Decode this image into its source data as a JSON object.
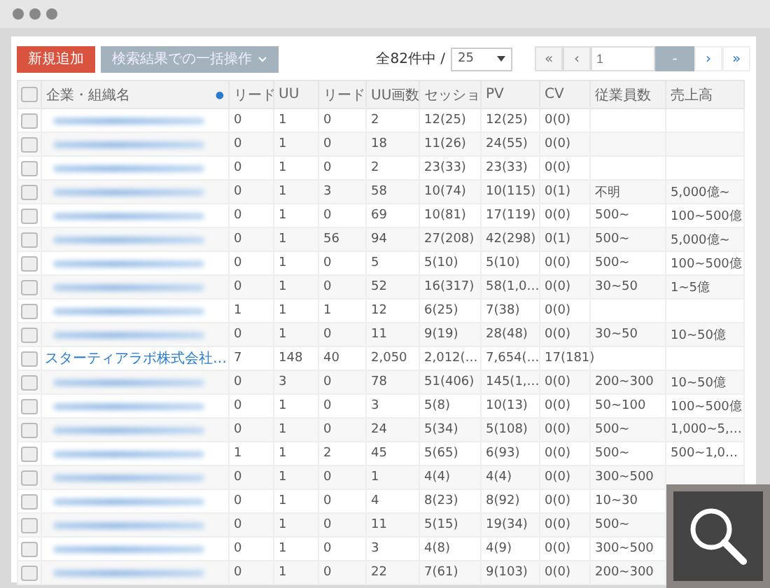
{
  "toolbar": {
    "add_button": "新規追加",
    "bulk_button": "検索結果での一括操作",
    "total": "全82件中 /",
    "per_page": "25",
    "first": "«",
    "prev": "‹",
    "page": "1",
    "page_total": "-",
    "next": "›",
    "last": "»"
  },
  "table": {
    "select_all_checked": false,
    "sort_mark": "●",
    "columns": [
      "企業・組織名",
      "リード",
      "UU",
      "リード",
      "UU画数",
      "セッショ",
      "PV",
      "CV",
      "従業員数",
      "売上高"
    ],
    "rows": [
      {
        "checked": false,
        "name": {
          "kind": "redacted"
        },
        "lead": "0",
        "uu": "1",
        "lead2": "0",
        "uucount": "2",
        "session": "12(25)",
        "pv": "12(25)",
        "cv": "0(0)"
      },
      {
        "checked": false,
        "name": {
          "kind": "redacted"
        },
        "lead": "0",
        "uu": "1",
        "lead2": "0",
        "uucount": "18",
        "session": "11(26)",
        "pv": "24(55)",
        "cv": "0(0)"
      },
      {
        "checked": false,
        "name": {
          "kind": "redacted"
        },
        "lead": "0",
        "uu": "1",
        "lead2": "0",
        "uucount": "2",
        "session": "23(33)",
        "pv": "23(33)",
        "cv": "0(0)"
      },
      {
        "checked": false,
        "name": {
          "kind": "redacted"
        },
        "lead": "0",
        "uu": "1",
        "lead2": "3",
        "uucount": "58",
        "session": "10(74)",
        "pv": "10(115)",
        "cv": "0(1)",
        "employees": "不明",
        "sales": "5,000億~"
      },
      {
        "checked": false,
        "name": {
          "kind": "redacted"
        },
        "lead": "0",
        "uu": "1",
        "lead2": "0",
        "uucount": "69",
        "session": "10(81)",
        "pv": "17(119)",
        "cv": "0(0)",
        "employees": "500~",
        "sales": "100~500億"
      },
      {
        "checked": false,
        "name": {
          "kind": "redacted"
        },
        "lead": "0",
        "uu": "1",
        "lead2": "56",
        "uucount": "94",
        "session": "27(208)",
        "pv": "42(298)",
        "cv": "0(1)",
        "employees": "500~",
        "sales": "5,000億~"
      },
      {
        "checked": false,
        "name": {
          "kind": "redacted"
        },
        "lead": "0",
        "uu": "1",
        "lead2": "0",
        "uucount": "5",
        "session": "5(10)",
        "pv": "5(10)",
        "cv": "0(0)",
        "employees": "500~",
        "sales": "100~500億"
      },
      {
        "checked": false,
        "name": {
          "kind": "redacted"
        },
        "lead": "0",
        "uu": "1",
        "lead2": "0",
        "uucount": "52",
        "session": "16(317)",
        "pv": "58(1,0…",
        "cv": "0(0)",
        "employees": "30~50",
        "sales": "1~5億"
      },
      {
        "checked": false,
        "name": {
          "kind": "redacted"
        },
        "lead": "1",
        "uu": "1",
        "lead2": "1",
        "uucount": "12",
        "session": "6(25)",
        "pv": "7(38)",
        "cv": "0(0)"
      },
      {
        "checked": false,
        "name": {
          "kind": "redacted"
        },
        "lead": "0",
        "uu": "1",
        "lead2": "0",
        "uucount": "11",
        "session": "9(19)",
        "pv": "28(48)",
        "cv": "0(0)",
        "employees": "30~50",
        "sales": "10~50億"
      },
      {
        "checked": false,
        "name": {
          "kind": "link",
          "text": "スターティアラボ株式会社…"
        },
        "lead": "7",
        "uu": "148",
        "lead2": "40",
        "uucount": "2,050",
        "session": "2,012(…",
        "pv": "7,654(…",
        "cv": "17(181)"
      },
      {
        "checked": false,
        "name": {
          "kind": "redacted"
        },
        "lead": "0",
        "uu": "3",
        "lead2": "0",
        "uucount": "78",
        "session": "51(406)",
        "pv": "145(1,…",
        "cv": "0(0)",
        "employees": "200~300",
        "sales": "10~50億"
      },
      {
        "checked": false,
        "name": {
          "kind": "redacted"
        },
        "lead": "0",
        "uu": "1",
        "lead2": "0",
        "uucount": "3",
        "session": "5(8)",
        "pv": "10(13)",
        "cv": "0(0)",
        "employees": "50~100",
        "sales": "100~500億"
      },
      {
        "checked": false,
        "name": {
          "kind": "redacted"
        },
        "lead": "0",
        "uu": "1",
        "lead2": "0",
        "uucount": "24",
        "session": "5(34)",
        "pv": "5(108)",
        "cv": "0(0)",
        "employees": "500~",
        "sales": "1,000~5,…"
      },
      {
        "checked": false,
        "name": {
          "kind": "redacted"
        },
        "lead": "1",
        "uu": "1",
        "lead2": "2",
        "uucount": "45",
        "session": "5(65)",
        "pv": "6(93)",
        "cv": "0(0)",
        "employees": "500~",
        "sales": "500~1,0…"
      },
      {
        "checked": false,
        "name": {
          "kind": "redacted"
        },
        "lead": "0",
        "uu": "1",
        "lead2": "0",
        "uucount": "1",
        "session": "4(4)",
        "pv": "4(4)",
        "cv": "0(0)",
        "employees": "300~500"
      },
      {
        "checked": false,
        "name": {
          "kind": "redacted"
        },
        "lead": "0",
        "uu": "1",
        "lead2": "0",
        "uucount": "4",
        "session": "8(23)",
        "pv": "8(92)",
        "cv": "0(0)",
        "employees": "10~30"
      },
      {
        "checked": false,
        "name": {
          "kind": "redacted"
        },
        "lead": "0",
        "uu": "1",
        "lead2": "0",
        "uucount": "11",
        "session": "5(15)",
        "pv": "19(34)",
        "cv": "0(0)",
        "employees": "500~"
      },
      {
        "checked": false,
        "name": {
          "kind": "redacted"
        },
        "lead": "0",
        "uu": "1",
        "lead2": "0",
        "uucount": "3",
        "session": "4(8)",
        "pv": "4(9)",
        "cv": "0(0)",
        "employees": "300~500"
      },
      {
        "checked": false,
        "name": {
          "kind": "redacted"
        },
        "lead": "0",
        "uu": "1",
        "lead2": "0",
        "uucount": "22",
        "session": "7(61)",
        "pv": "9(103)",
        "cv": "0(0)",
        "employees": "200~300"
      }
    ]
  }
}
